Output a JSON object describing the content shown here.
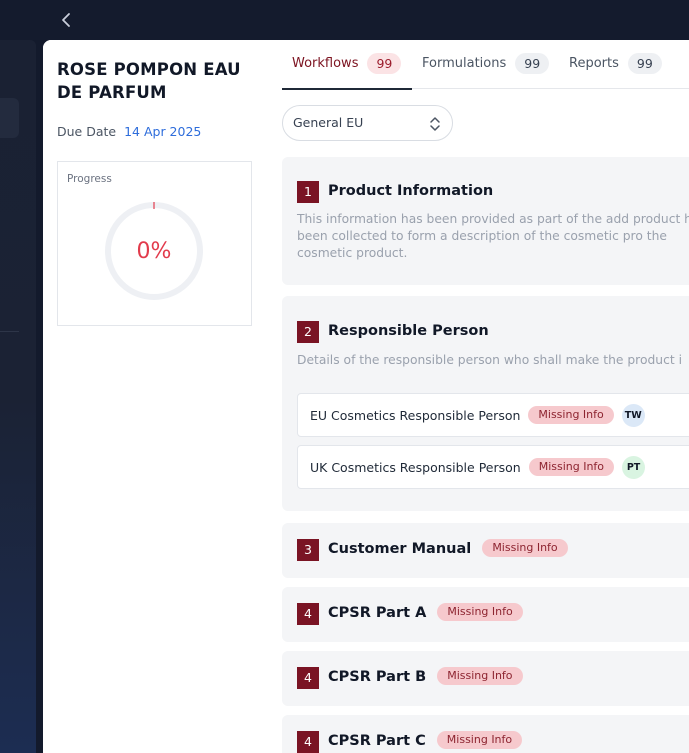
{
  "product": {
    "title": "ROSE POMPON EAU DE PARFUM",
    "due_label": "Due Date",
    "due_value": "14 Apr 2025"
  },
  "progress": {
    "label": "Progress",
    "value_text": "0%",
    "fraction": 0
  },
  "tabs": [
    {
      "label": "Workflows",
      "count": "99",
      "active": true
    },
    {
      "label": "Formulations",
      "count": "99",
      "active": false
    },
    {
      "label": "Reports",
      "count": "99",
      "active": false
    }
  ],
  "region_select": {
    "value": "General EU"
  },
  "sections": [
    {
      "number": "1",
      "title": "Product Information",
      "description": "This information has been provided as part of the add product have been collected to form a description of the cosmetic pro the cosmetic product."
    },
    {
      "number": "2",
      "title": "Responsible Person",
      "description": "Details of the responsible person who shall make the product i",
      "items": [
        {
          "label": "EU Cosmetics Responsible Person",
          "status": "Missing Info",
          "avatar": "TW"
        },
        {
          "label": "UK Cosmetics Responsible Person",
          "status": "Missing Info",
          "avatar": "PT"
        }
      ]
    },
    {
      "number": "3",
      "title": "Customer Manual",
      "status": "Missing Info"
    },
    {
      "number": "4",
      "title": "CPSR Part A",
      "status": "Missing Info"
    },
    {
      "number": "4",
      "title": "CPSR Part B",
      "status": "Missing Info"
    },
    {
      "number": "4",
      "title": "CPSR Part C",
      "status": "Missing Info"
    }
  ],
  "colors": {
    "accent": "#7a1424",
    "badge_bg": "#f6c9cd",
    "progress_text": "#e23b4c",
    "due_date": "#2e6ddb"
  },
  "icons": {
    "back": "chevron-left-icon",
    "select": "chevron-up-down-icon"
  }
}
